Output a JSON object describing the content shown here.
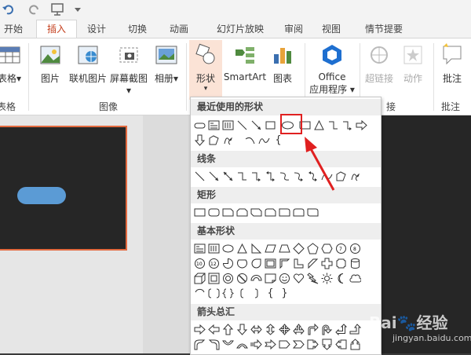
{
  "quick_access": {
    "icons": [
      "undo-icon",
      "redo-icon",
      "start-from-beginning-icon",
      "customize-qat-icon"
    ]
  },
  "tabs": [
    "开始",
    "插入",
    "设计",
    "切换",
    "动画",
    "幻灯片放映",
    "审阅",
    "视图",
    "情节提要"
  ],
  "active_tab": "插入",
  "ribbon": {
    "table": {
      "label": "表格",
      "sub": "▾"
    },
    "picture": {
      "label": "图片"
    },
    "online_picture": {
      "label": "联机图片"
    },
    "screenshot": {
      "label": "屏幕截图",
      "sub": "▾"
    },
    "album": {
      "label": "相册",
      "sub": "▾"
    },
    "shapes": {
      "label": "形状",
      "sub": "▾"
    },
    "smartart": {
      "label": "SmartArt"
    },
    "chart": {
      "label": "图表"
    },
    "office_apps": {
      "label": "Office",
      "label2": "应用程序 ▾"
    },
    "hyperlink": {
      "label": "超链接"
    },
    "action": {
      "label": "动作"
    },
    "comment": {
      "label": "批注"
    },
    "groups": {
      "table": "表格",
      "image": "图像",
      "links": "接",
      "comments": "批注"
    }
  },
  "gallery": {
    "sections": {
      "recent": "最近使用的形状",
      "lines": "线条",
      "rectangles": "矩形",
      "basic": "基本形状",
      "arrows": "箭头总汇"
    },
    "brace_glyph": "{",
    "brace_close": "}"
  },
  "watermark": {
    "brand": "Bai",
    "brand2": "经验",
    "url": "jingyan.baidu.com"
  },
  "colors": {
    "accent": "#c43e1c",
    "highlight": "#e02020",
    "shape_fill": "#5b9bd5",
    "thumb_border": "#e36a3f"
  }
}
